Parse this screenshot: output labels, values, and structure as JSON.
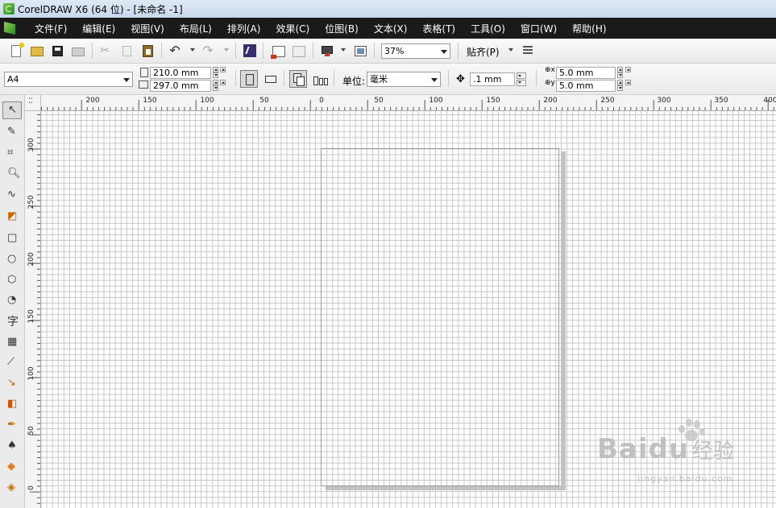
{
  "window": {
    "title": "CorelDRAW X6 (64 位) - [未命名 -1]"
  },
  "menubar": {
    "items": [
      "文件(F)",
      "编辑(E)",
      "视图(V)",
      "布局(L)",
      "排列(A)",
      "效果(C)",
      "位图(B)",
      "文本(X)",
      "表格(T)",
      "工具(O)",
      "窗口(W)",
      "帮助(H)"
    ]
  },
  "toolbar": {
    "zoom_value": "37%",
    "snap_label": "贴齐(P)"
  },
  "property_bar": {
    "paper_size": "A4",
    "width": "210.0 mm",
    "height": "297.0 mm",
    "units_label": "单位:",
    "units_value": "毫米",
    "nudge": ".1 mm",
    "dup_x": "5.0 mm",
    "dup_y": "5.0 mm"
  },
  "toolbox": {
    "text_tool_glyph": "字",
    "icons": [
      "pick-tool-icon",
      "shape-tool-icon",
      "crop-tool-icon",
      "zoom-tool-icon",
      "freehand-tool-icon",
      "smart-fill-tool-icon",
      "rectangle-tool-icon",
      "ellipse-tool-icon",
      "polygon-tool-icon",
      "basic-shapes-tool-icon",
      "text-tool-icon",
      "table-tool-icon",
      "dimension-tool-icon",
      "connector-tool-icon",
      "blend-tool-icon",
      "eyedropper-tool-icon",
      "outline-pen-tool-icon",
      "fill-tool-icon",
      "interactive-fill-tool-icon"
    ]
  },
  "rulers": {
    "horizontal": [
      "200",
      "150",
      "100",
      "50",
      "0",
      "50",
      "100",
      "150",
      "200",
      "250",
      "300",
      "350",
      "400"
    ],
    "vertical": [
      "300",
      "250",
      "200",
      "150",
      "100",
      "50",
      "0"
    ]
  },
  "watermark": {
    "brand": "Baidu",
    "cn": "经验",
    "url": "jingyan.baidu.com"
  }
}
